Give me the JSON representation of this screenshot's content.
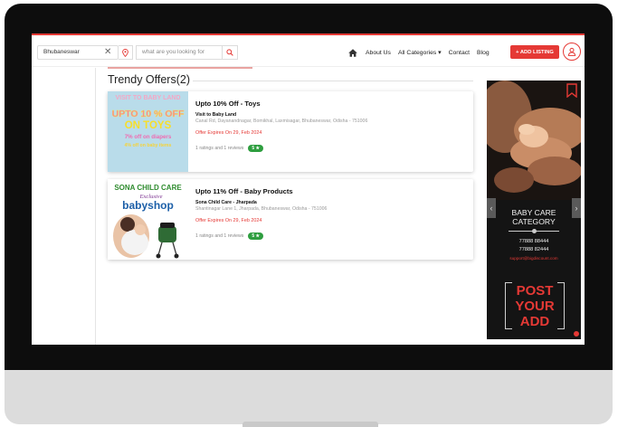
{
  "header": {
    "location_value": "Bhubaneswar",
    "clear_glyph": "✕",
    "search_placeholder": "what are you looking for",
    "nav": {
      "about": "About Us",
      "categories": "All Categories ▾",
      "contact": "Contact",
      "blog": "Blog"
    },
    "add_listing": "+ ADD LISTING"
  },
  "main": {
    "section_title": "Trendy Offers(2)",
    "offers": [
      {
        "title": "Upto 10% Off - Toys",
        "merchant": "Visit to Baby Land",
        "address": "Canal Rd, Dayanandnagar, Bomikhal, Laxmisagar, Bhubaneswar, Odisha - 751006",
        "expiry": "Offer Expires On 29, Feb 2024",
        "ratings_text": "1 ratings and 1 reviews",
        "rating": "5 ★",
        "image": {
          "line1": "VISIT TO BABY LAND",
          "line2": "UPTO 10 % OFF",
          "line3": "ON TOYS",
          "line4": "7% off on diapers",
          "line5": "4% off on baby items"
        }
      },
      {
        "title": "Upto 11% Off - Baby Products",
        "merchant": "Sona Child Care - Jharpada",
        "address": "Shantinagar Lane 1, Jharpada, Bhubaneswar, Odisha - 751006",
        "expiry": "Offer Expires On 29, Feb 2024",
        "ratings_text": "1 ratings and 1 reviews",
        "rating": "5 ★",
        "image": {
          "line1": "SONA CHILD CARE",
          "line2": "Exclusive",
          "line3": "babyshop"
        }
      }
    ]
  },
  "ad": {
    "heading_line1": "BABY CARE",
    "heading_line2": "CATEGORY",
    "phone1": "77888 88444",
    "phone2": "77888 82444",
    "email": "support@bigdiscount.com",
    "post_line1": "POST",
    "post_line2": "YOUR",
    "post_line3": "ADD",
    "arrow_left": "‹",
    "arrow_right": "›"
  },
  "icons": {
    "home": "home-icon",
    "pin": "map-pin-icon",
    "search": "search-icon",
    "user": "user-icon",
    "bookmark": "bookmark-icon"
  },
  "colors": {
    "accent": "#e53935",
    "rating_badge": "#2e9e3f",
    "bezel": "#0d0d0d",
    "chin": "#dcdcdc"
  }
}
